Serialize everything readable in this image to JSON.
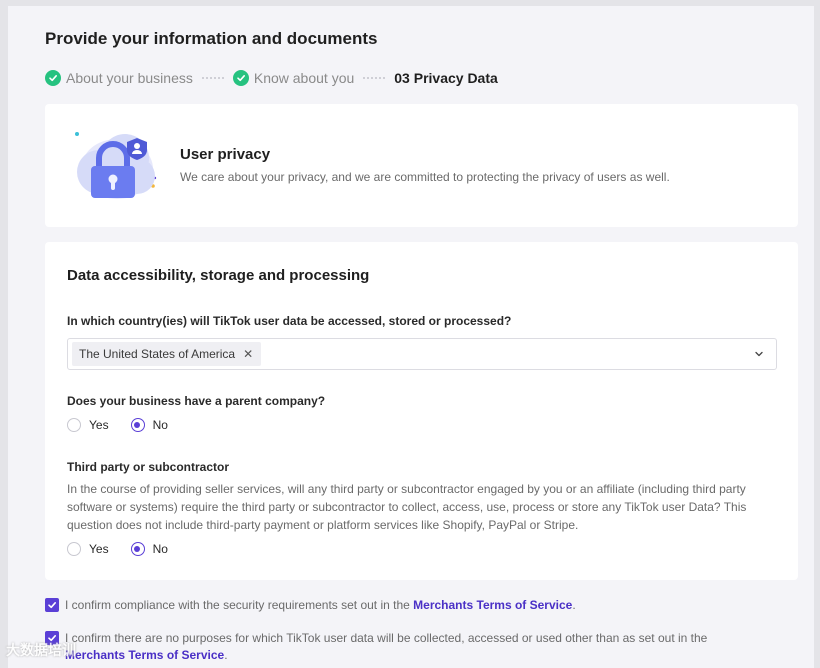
{
  "page": {
    "title": "Provide your information and documents"
  },
  "steps": [
    {
      "label": "About your business",
      "state": "done"
    },
    {
      "label": "Know about you",
      "state": "done"
    },
    {
      "label": "03 Privacy Data",
      "state": "active"
    }
  ],
  "privacy": {
    "title": "User privacy",
    "description": "We care about your privacy, and we are committed to protecting the privacy of users as well."
  },
  "data_section": {
    "title": "Data accessibility, storage and processing",
    "country_question": "In which country(ies) will TikTok user data be accessed, stored or processed?",
    "country_selected": "The United States of America",
    "parent_question": "Does your business have a parent company?",
    "parent_options": {
      "yes": "Yes",
      "no": "No",
      "selected": "No"
    },
    "third_party_title": "Third party or subcontractor",
    "third_party_desc": "In the course of providing seller services, will any third party or subcontractor engaged by you or an affiliate (including third party software or systems) require the third party or subcontractor to collect, access, use, process or store any TikTok user Data? This question does not include third-party payment or platform services like Shopify, PayPal or Stripe.",
    "third_party_options": {
      "yes": "Yes",
      "no": "No",
      "selected": "No"
    }
  },
  "confirmations": {
    "first_text": "I confirm compliance with the security requirements set out in the ",
    "first_link": "Merchants Terms of Service",
    "first_end": ".",
    "second_text": "I confirm there are no purposes for which TikTok user data will be collected, accessed or used other than as set out in the ",
    "second_link": "Merchants Terms of Service",
    "second_end": "."
  },
  "watermark": "大数据培训",
  "colors": {
    "accent": "#5a3fd6",
    "success": "#26c280",
    "link": "#4a30c6"
  }
}
